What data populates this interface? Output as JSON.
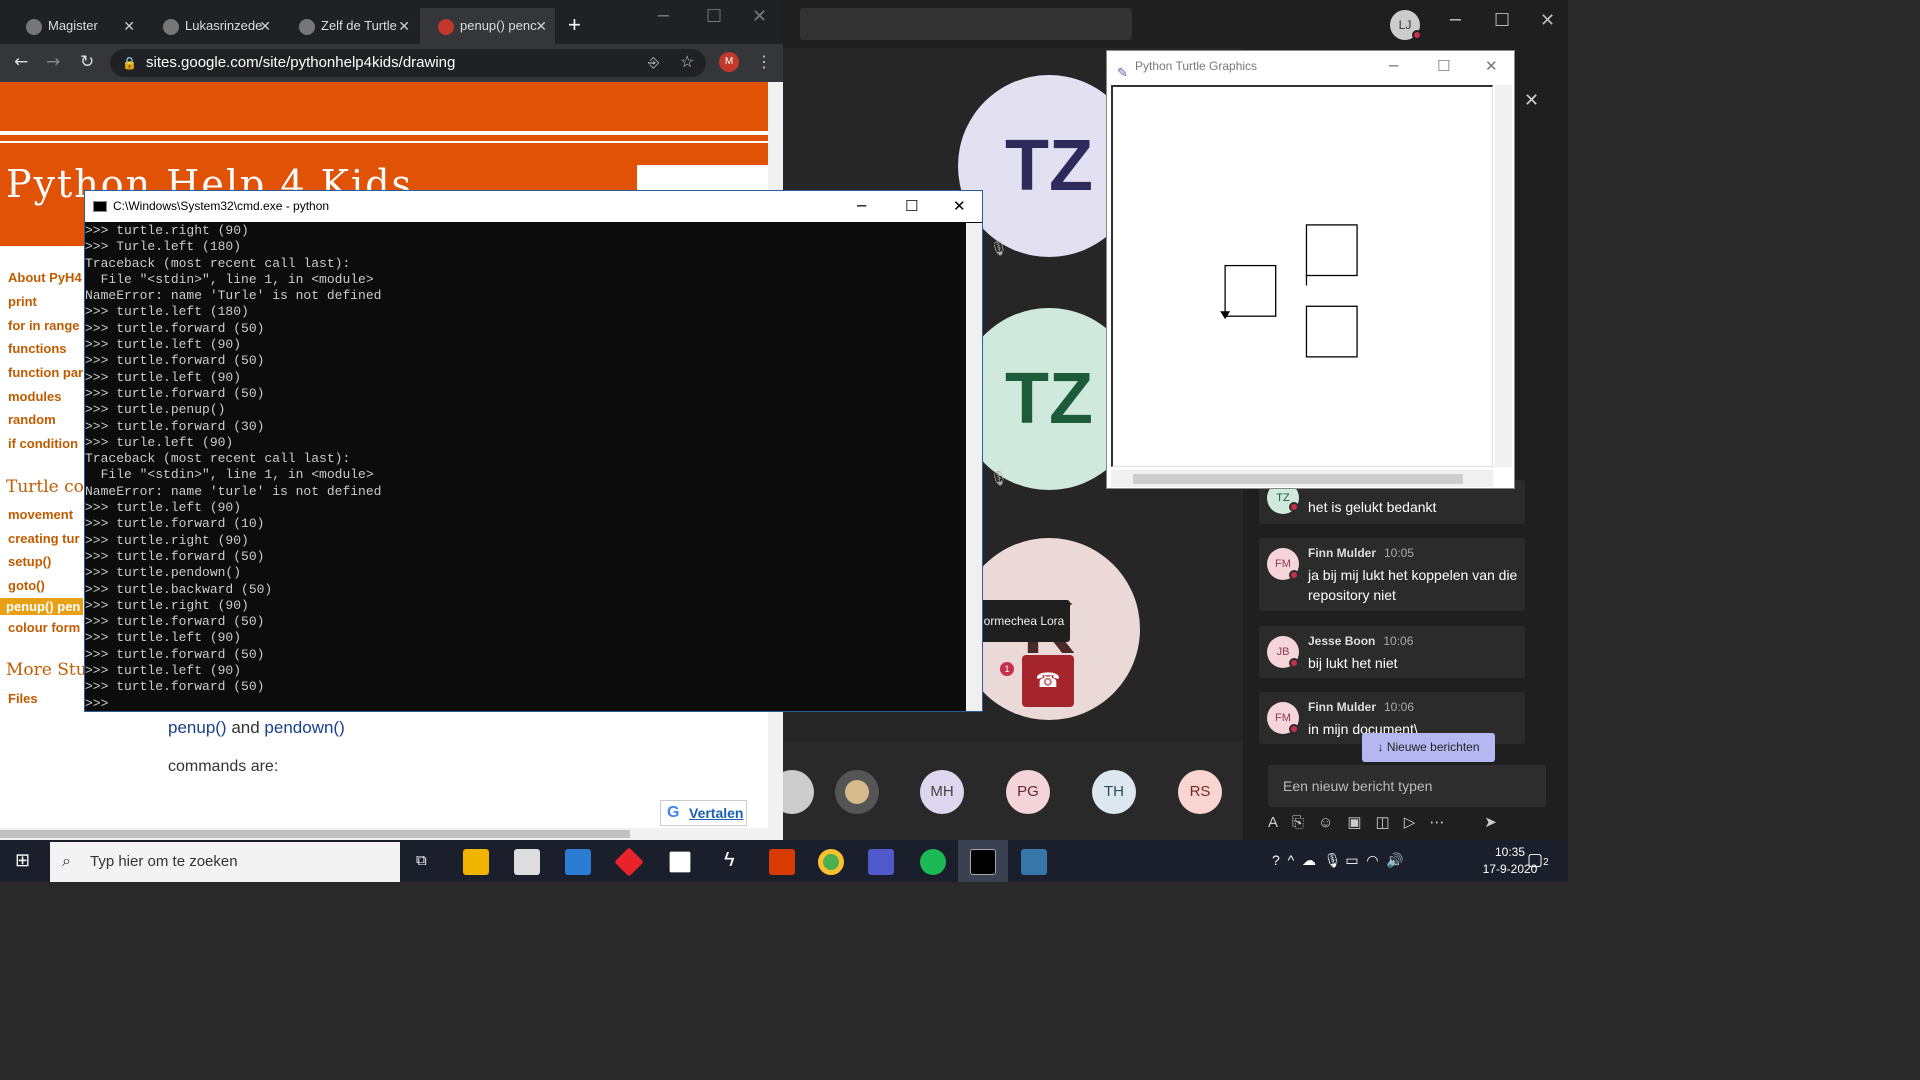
{
  "chrome": {
    "tabs": [
      {
        "label": "Magister"
      },
      {
        "label": "Lukasrinzede"
      },
      {
        "label": "Zelf de Turtle"
      },
      {
        "label": "penup() penc"
      }
    ],
    "url": "sites.google.com/site/pythonhelp4kids/drawing"
  },
  "site": {
    "title": "Python Help 4 Kids",
    "nav": [
      "About PyH4",
      "print",
      "for in range",
      "functions",
      "function par",
      "modules",
      "random",
      "if condition"
    ],
    "turtle_heading": "Turtle con",
    "turtle_nav": [
      "movement",
      "creating tur",
      "setup()",
      "goto()",
      "penup() pen",
      "colour form"
    ],
    "more_heading": "More Stuf",
    "files": "Files",
    "penup_fn": "penup()",
    "and": " and ",
    "pendown_fn": "pendown()",
    "commands_are": "commands are:",
    "vertalen": "Vertalen"
  },
  "cmd": {
    "title": "C:\\Windows\\System32\\cmd.exe - python",
    "lines": [
      ">>> turtle.right (90)",
      ">>> Turle.left (180)",
      "Traceback (most recent call last):",
      "  File \"<stdin>\", line 1, in <module>",
      "NameError: name 'Turle' is not defined",
      ">>> turtle.left (180)",
      ">>> turtle.forward (50)",
      ">>> turtle.left (90)",
      ">>> turtle.forward (50)",
      ">>> turtle.left (90)",
      ">>> turtle.forward (50)",
      ">>> turtle.penup()",
      ">>> turtle.forward (30)",
      ">>> turle.left (90)",
      "Traceback (most recent call last):",
      "  File \"<stdin>\", line 1, in <module>",
      "NameError: name 'turle' is not defined",
      ">>> turtle.left (90)",
      ">>> turtle.forward (10)",
      ">>> turtle.right (90)",
      ">>> turtle.forward (50)",
      ">>> turtle.pendown()",
      ">>> turtle.backward (50)",
      ">>> turtle.right (90)",
      ">>> turtle.forward (50)",
      ">>> turtle.left (90)",
      ">>> turtle.forward (50)",
      ">>> turtle.left (90)",
      ">>> turtle.forward (50)",
      ">>>"
    ]
  },
  "turtle_window": {
    "title": "Python Turtle Graphics"
  },
  "teams": {
    "user_initials": "LJ",
    "participants": [
      "TZ",
      "TZ",
      "K"
    ],
    "tooltip": "ormechea Lora",
    "participants_badge": "1",
    "roster": [
      "",
      "",
      "MH",
      "PG",
      "TH",
      "RS"
    ],
    "messages": [
      {
        "initials": "TZ",
        "name": "",
        "time": "",
        "text": "het is gelukt bedankt"
      },
      {
        "initials": "FM",
        "name": "Finn Mulder",
        "time": "10:05",
        "text": "ja bij mij lukt het koppelen van die repository niet"
      },
      {
        "initials": "JB",
        "name": "Jesse Boon",
        "time": "10:06",
        "text": "bij lukt het niet"
      },
      {
        "initials": "FM",
        "name": "Finn Mulder",
        "time": "10:06",
        "text": "in mijn document\\"
      }
    ],
    "new_messages": "Nieuwe berichten",
    "compose_placeholder": "Een nieuw bericht typen"
  },
  "taskbar": {
    "search_placeholder": "Typ hier om te zoeken",
    "time": "10:35",
    "date": "17-9-2020",
    "notif_count": "2"
  },
  "colors": {
    "site_orange": "#e05206",
    "teams_hangup": "#a4262c",
    "chrome_dark": "#202124"
  }
}
